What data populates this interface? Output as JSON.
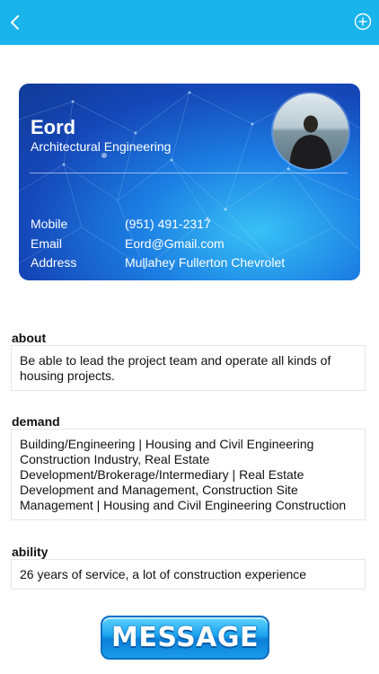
{
  "topbar": {
    "back_icon": "chevron-left-icon",
    "add_icon": "plus-circle-icon",
    "color": "#19b4ec"
  },
  "card": {
    "name": "Eord",
    "title": "Architectural Engineering",
    "rows": [
      {
        "label": "Mobile",
        "value": "(951) 491-2317"
      },
      {
        "label": "Email",
        "value": "Eord@Gmail.com"
      },
      {
        "label": "Address",
        "value": "Mullahey Fullerton Chevrolet"
      }
    ]
  },
  "sections": [
    {
      "title": "about",
      "text": "Be able to lead the project team and operate all kinds of housing projects."
    },
    {
      "title": "demand",
      "text": "Building/Engineering | Housing and Civil Engineering Construction Industry, Real Estate Development/Brokerage/Intermediary | Real Estate Development and Management, Construction Site Management | Housing and Civil Engineering Construction"
    },
    {
      "title": "ability",
      "text": "26 years of service, a lot of construction experience"
    }
  ],
  "message_button": {
    "label": "MESSAGE"
  }
}
